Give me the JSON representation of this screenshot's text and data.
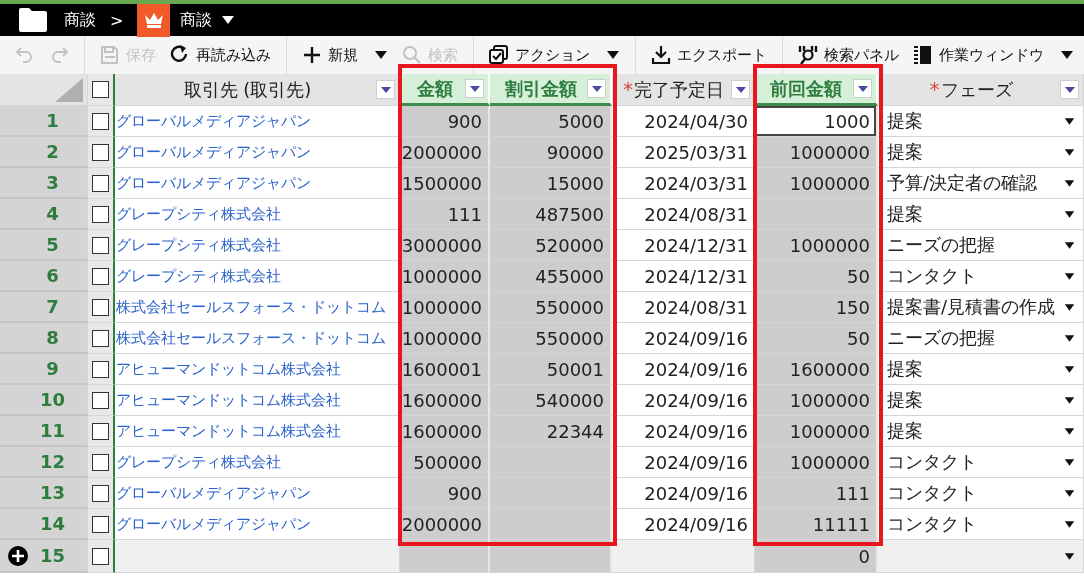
{
  "breadcrumb": {
    "folder": "商談",
    "separator": ">",
    "object": "商談"
  },
  "toolbar": {
    "groups": [
      [
        {
          "kind": "icon",
          "disabled": true
        },
        {
          "kind": "icon",
          "disabled": true
        }
      ],
      [
        {
          "kind": "button",
          "label": "保存",
          "disabled": true
        },
        {
          "kind": "button",
          "label": "再読み込み",
          "disabled": false
        }
      ],
      [
        {
          "kind": "menu",
          "label": "新規",
          "disabled": false
        },
        {
          "kind": "button",
          "label": "検索",
          "disabled": true
        }
      ],
      [
        {
          "kind": "menu",
          "label": "アクション",
          "disabled": false
        }
      ],
      [
        {
          "kind": "button",
          "label": "エクスポート",
          "disabled": false
        }
      ],
      [
        {
          "kind": "button",
          "label": "検索パネル",
          "disabled": false
        },
        {
          "kind": "menu",
          "label": "作業ウィンドウ",
          "disabled": false
        }
      ]
    ]
  },
  "table": {
    "all_checked": false,
    "columns": [
      {
        "label": "取引先 (取引先)",
        "kind": "link",
        "highlighted": false,
        "readonly": false
      },
      {
        "label": "金額",
        "kind": "number",
        "highlighted": true,
        "readonly": true
      },
      {
        "label": "割引金額",
        "kind": "number",
        "highlighted": true,
        "readonly": true
      },
      {
        "label": "完了予定日",
        "kind": "number",
        "highlighted": false,
        "readonly": false,
        "required_mark": "*"
      },
      {
        "label": "前回金額",
        "kind": "number",
        "highlighted": true,
        "readonly": true
      },
      {
        "label": "フェーズ",
        "kind": "picklist",
        "highlighted": false,
        "readonly": false,
        "required_mark": "*"
      }
    ],
    "rows": [
      {
        "kind": "record",
        "number": "1",
        "checked": false,
        "cells": [
          {
            "text": "グローバルメディアジャパン",
            "selected": false
          },
          {
            "text": "900",
            "selected": false
          },
          {
            "text": "5000",
            "selected": false
          },
          {
            "text": "2024/04/30",
            "selected": false
          },
          {
            "text": "1000",
            "selected": true
          },
          {
            "text": "提案",
            "selected": false
          }
        ]
      },
      {
        "kind": "record",
        "number": "2",
        "checked": false,
        "cells": [
          {
            "text": "グローバルメディアジャパン",
            "selected": false
          },
          {
            "text": "2000000",
            "selected": false
          },
          {
            "text": "90000",
            "selected": false
          },
          {
            "text": "2025/03/31",
            "selected": false
          },
          {
            "text": "1000000",
            "selected": false
          },
          {
            "text": "提案",
            "selected": false
          }
        ]
      },
      {
        "kind": "record",
        "number": "3",
        "checked": false,
        "cells": [
          {
            "text": "グローバルメディアジャパン",
            "selected": false
          },
          {
            "text": "1500000",
            "selected": false
          },
          {
            "text": "15000",
            "selected": false
          },
          {
            "text": "2024/03/31",
            "selected": false
          },
          {
            "text": "1000000",
            "selected": false
          },
          {
            "text": "予算/決定者の確認",
            "selected": false
          }
        ]
      },
      {
        "kind": "record",
        "number": "4",
        "checked": false,
        "cells": [
          {
            "text": "グレープシティ株式会社",
            "selected": false
          },
          {
            "text": "111",
            "selected": false
          },
          {
            "text": "487500",
            "selected": false
          },
          {
            "text": "2024/08/31",
            "selected": false
          },
          {
            "selected": false
          },
          {
            "text": "提案",
            "selected": false
          }
        ]
      },
      {
        "kind": "record",
        "number": "5",
        "checked": false,
        "cells": [
          {
            "text": "グレープシティ株式会社",
            "selected": false
          },
          {
            "text": "3000000",
            "selected": false
          },
          {
            "text": "520000",
            "selected": false
          },
          {
            "text": "2024/12/31",
            "selected": false
          },
          {
            "text": "1000000",
            "selected": false
          },
          {
            "text": "ニーズの把握",
            "selected": false
          }
        ]
      },
      {
        "kind": "record",
        "number": "6",
        "checked": false,
        "cells": [
          {
            "text": "グレープシティ株式会社",
            "selected": false
          },
          {
            "text": "1000000",
            "selected": false
          },
          {
            "text": "455000",
            "selected": false
          },
          {
            "text": "2024/12/31",
            "selected": false
          },
          {
            "text": "50",
            "selected": false
          },
          {
            "text": "コンタクト",
            "selected": false
          }
        ]
      },
      {
        "kind": "record",
        "number": "7",
        "checked": false,
        "cells": [
          {
            "text": "株式会社セールスフォース・ドットコム",
            "selected": false
          },
          {
            "text": "1000000",
            "selected": false
          },
          {
            "text": "550000",
            "selected": false
          },
          {
            "text": "2024/08/31",
            "selected": false
          },
          {
            "text": "150",
            "selected": false
          },
          {
            "text": "提案書/見積書の作成",
            "selected": false
          }
        ]
      },
      {
        "kind": "record",
        "number": "8",
        "checked": false,
        "cells": [
          {
            "text": "株式会社セールスフォース・ドットコム",
            "selected": false
          },
          {
            "text": "1000000",
            "selected": false
          },
          {
            "text": "550000",
            "selected": false
          },
          {
            "text": "2024/09/16",
            "selected": false
          },
          {
            "text": "50",
            "selected": false
          },
          {
            "text": "ニーズの把握",
            "selected": false
          }
        ]
      },
      {
        "kind": "record",
        "number": "9",
        "checked": false,
        "cells": [
          {
            "text": "アヒューマンドットコム株式会社",
            "selected": false
          },
          {
            "text": "1600001",
            "selected": false
          },
          {
            "text": "50001",
            "selected": false
          },
          {
            "text": "2024/09/16",
            "selected": false
          },
          {
            "text": "1600000",
            "selected": false
          },
          {
            "text": "提案",
            "selected": false
          }
        ]
      },
      {
        "kind": "record",
        "number": "10",
        "checked": false,
        "cells": [
          {
            "text": "アヒューマンドットコム株式会社",
            "selected": false
          },
          {
            "text": "1600000",
            "selected": false
          },
          {
            "text": "540000",
            "selected": false
          },
          {
            "text": "2024/09/16",
            "selected": false
          },
          {
            "text": "1000000",
            "selected": false
          },
          {
            "text": "提案",
            "selected": false
          }
        ]
      },
      {
        "kind": "record",
        "number": "11",
        "checked": false,
        "cells": [
          {
            "text": "アヒューマンドットコム株式会社",
            "selected": false
          },
          {
            "text": "1600000",
            "selected": false
          },
          {
            "text": "22344",
            "selected": false
          },
          {
            "text": "2024/09/16",
            "selected": false
          },
          {
            "text": "1000000",
            "selected": false
          },
          {
            "text": "提案",
            "selected": false
          }
        ]
      },
      {
        "kind": "record",
        "number": "12",
        "checked": false,
        "cells": [
          {
            "text": "グレープシティ株式会社",
            "selected": false
          },
          {
            "text": "500000",
            "selected": false
          },
          {
            "selected": false
          },
          {
            "text": "2024/09/16",
            "selected": false
          },
          {
            "text": "1000000",
            "selected": false
          },
          {
            "text": "コンタクト",
            "selected": false
          }
        ]
      },
      {
        "kind": "record",
        "number": "13",
        "checked": false,
        "cells": [
          {
            "text": "グローバルメディアジャパン",
            "selected": false
          },
          {
            "text": "900",
            "selected": false
          },
          {
            "selected": false
          },
          {
            "text": "2024/09/16",
            "selected": false
          },
          {
            "text": "111",
            "selected": false
          },
          {
            "text": "コンタクト",
            "selected": false
          }
        ]
      },
      {
        "kind": "record",
        "number": "14",
        "checked": false,
        "cells": [
          {
            "text": "グローバルメディアジャパン",
            "selected": false
          },
          {
            "text": "2000000",
            "selected": false
          },
          {
            "selected": false
          },
          {
            "text": "2024/09/16",
            "selected": false
          },
          {
            "text": "11111",
            "selected": false
          },
          {
            "text": "コンタクト",
            "selected": false
          }
        ]
      },
      {
        "kind": "new",
        "number": "15",
        "checked": false,
        "cells": [
          {
            "selected": false
          },
          {
            "selected": false
          },
          {
            "selected": false
          },
          {
            "selected": false
          },
          {
            "text": "0",
            "selected": false
          },
          {
            "selected": false
          }
        ]
      }
    ]
  }
}
